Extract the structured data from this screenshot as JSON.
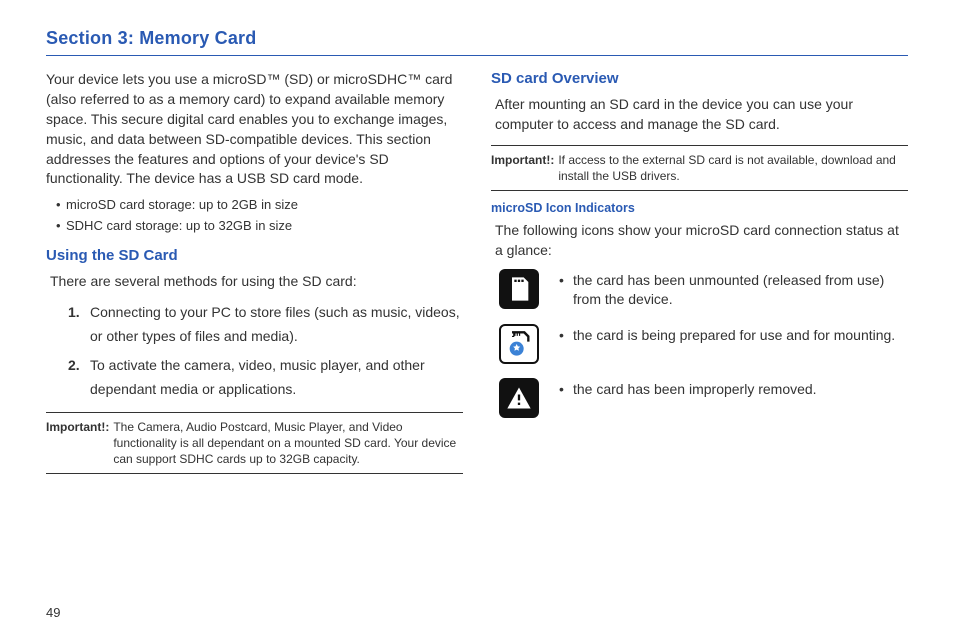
{
  "section_title": "Section 3: Memory Card",
  "left": {
    "intro": "Your device lets you use a microSD™ (SD) or microSDHC™ card (also referred to as a memory card) to expand available memory space. This secure digital card enables you to exchange images, music, and data between SD-compatible devices. This section addresses the features and options of your device's SD functionality. The device has a USB SD card mode.",
    "bullets": [
      "microSD card storage: up to 2GB in size",
      "SDHC card storage: up to 32GB in size"
    ],
    "h2": "Using the SD Card",
    "body1": "There are several methods for using the SD card:",
    "steps": [
      "Connecting to your PC to store files (such as music, videos, or other types of files and media).",
      "To activate the camera, video, music player, and other dependant media or applications."
    ],
    "important_label": "Important!:",
    "important_text": "The Camera, Audio Postcard, Music Player, and Video functionality is all dependant on a mounted SD card. Your device can support SDHC cards up to 32GB capacity."
  },
  "right": {
    "h2": "SD card Overview",
    "body1": "After mounting an SD card in the device you can use your computer to access and manage the SD card.",
    "important_label": "Important!:",
    "important_text": "If access to the external SD card is not available, download and install the USB drivers.",
    "h3": "microSD Icon Indicators",
    "body2": "The following icons show your microSD card connection status at a glance:",
    "icon_rows": [
      "the card has been unmounted (released from use) from the device.",
      "the card is being prepared for use and for mounting.",
      "the card has been improperly removed."
    ]
  },
  "page_number": "49"
}
